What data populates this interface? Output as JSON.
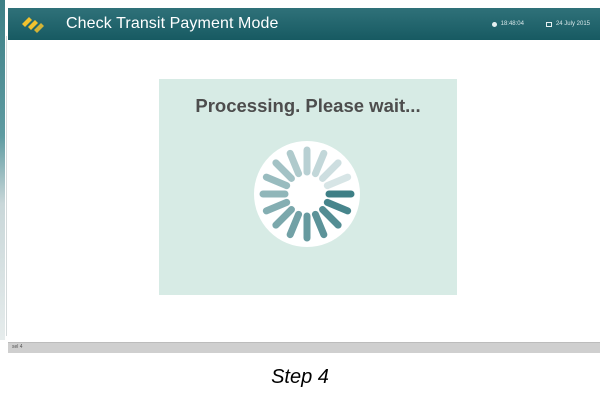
{
  "header": {
    "title": "Check Transit Payment Mode",
    "time": "18:48:04",
    "date": "24 July 2015",
    "logo_icon": "company-logo"
  },
  "panel": {
    "message": "Processing. Please wait...",
    "spinner_icon": "loading-spinner-icon"
  },
  "status_bar": {
    "text": "sel 4"
  },
  "caption": "Step 4",
  "colors": {
    "header": "#175a62",
    "panel_bg": "#d7ebe5",
    "spinner": "#3e7f86"
  }
}
